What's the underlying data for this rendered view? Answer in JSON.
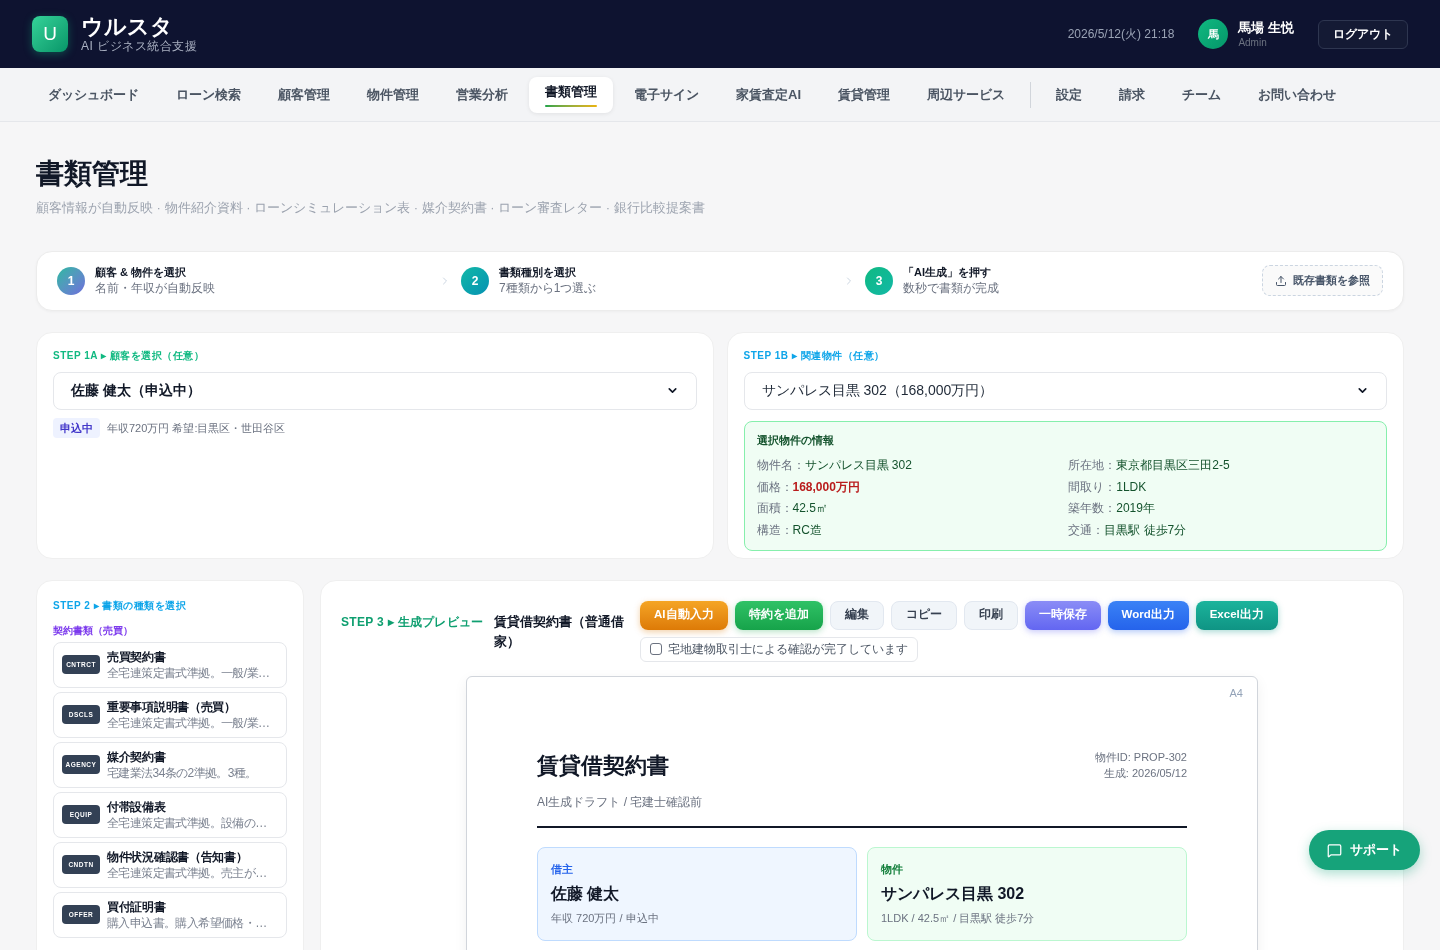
{
  "header": {
    "logo_mark": "U",
    "app_name": "ウルスタ",
    "tagline": "AI ビジネス統合支援",
    "datetime": "2026/5/12(火) 21:18",
    "user": {
      "avatar_initial": "馬",
      "name": "馬場 生悦",
      "role": "Admin"
    },
    "logout_label": "ログアウト"
  },
  "nav": {
    "primary": [
      {
        "label": "ダッシュボード",
        "selected": false
      },
      {
        "label": "ローン検索",
        "selected": false
      },
      {
        "label": "顧客管理",
        "selected": false
      },
      {
        "label": "物件管理",
        "selected": false
      },
      {
        "label": "営業分析",
        "selected": false
      },
      {
        "label": "書類管理",
        "selected": true
      },
      {
        "label": "電子サイン",
        "selected": false
      },
      {
        "label": "家賃査定AI",
        "selected": false
      },
      {
        "label": "賃貸管理",
        "selected": false
      },
      {
        "label": "周辺サービス",
        "selected": false
      }
    ],
    "secondary": [
      {
        "label": "設定",
        "selected": false
      },
      {
        "label": "請求",
        "selected": false
      },
      {
        "label": "チーム",
        "selected": false
      },
      {
        "label": "お問い合わせ",
        "selected": false
      }
    ]
  },
  "page": {
    "title": "書類管理",
    "subtitle": "顧客情報が自動反映 · 物件紹介資料 · ローンシミュレーション表 · 媒介契約書 · ローン審査レター · 銀行比較提案書"
  },
  "steps": [
    {
      "number": "1",
      "title": "顧客 & 物件を選択",
      "hint": "名前・年収が自動反映"
    },
    {
      "number": "2",
      "title": "書類種別を選択",
      "hint": "7種類から1つ選ぶ"
    },
    {
      "number": "3",
      "title": "「AI生成」を押す",
      "hint": "数秒で書類が完成"
    }
  ],
  "browse_button": "既存書類を参照",
  "customer_panel": {
    "label": "STEP 1A ▸ 顧客を選択（任意）",
    "select_value": "佐藤 健太（申込中）",
    "status": "申込中",
    "summary": "年収720万円 希望:目黒区・世田谷区"
  },
  "property_panel": {
    "label": "STEP 1B ▸ 関連物件（任意）",
    "select_value": "サンパレス目黒 302（168,000万円）",
    "info": {
      "title": "選択物件の情報",
      "fields": [
        {
          "label": "物件名：",
          "value": "サンパレス目黒 302",
          "highlighted": false
        },
        {
          "label": "所在地：",
          "value": "東京都目黒区三田2-5",
          "highlighted": false
        },
        {
          "label": "価格：",
          "value": "168,000万円",
          "highlighted": true
        },
        {
          "label": "間取り：",
          "value": "1LDK",
          "highlighted": false
        },
        {
          "label": "面積：",
          "value": "42.5㎡",
          "highlighted": false
        },
        {
          "label": "築年数：",
          "value": "2019年",
          "highlighted": false
        },
        {
          "label": "構造：",
          "value": "RC造",
          "highlighted": false
        },
        {
          "label": "交通：",
          "value": "目黒駅 徒歩7分",
          "highlighted": false
        }
      ]
    }
  },
  "document_types": {
    "label": "STEP 2 ▸ 書類の種類を選択",
    "group": "契約書類（売買）",
    "items": [
      {
        "code": "CNTRCT",
        "title": "売買契約書",
        "description": "全宅連策定書式準拠。一般/業…",
        "selected": false
      },
      {
        "code": "DSCLS",
        "title": "重要事項説明書（売買）",
        "description": "全宅連策定書式準拠。一般/業…",
        "selected": false
      },
      {
        "code": "AGENCY",
        "title": "媒介契約書",
        "description": "宅建業法34条の2準拠。3種。",
        "selected": false
      },
      {
        "code": "EQUIP",
        "title": "付帯設備表",
        "description": "全宅連策定書式準拠。設備の…",
        "selected": false
      },
      {
        "code": "CNDTN",
        "title": "物件状況確認書（告知書）",
        "description": "全宅連策定書式準拠。売主が…",
        "selected": false
      },
      {
        "code": "OFFER",
        "title": "買付証明書",
        "description": "購入申込書。購入希望価格・…",
        "selected": false
      }
    ]
  },
  "preview": {
    "label": "STEP 3 ▸ 生成プレビュー",
    "title": "賃貸借契約書（普通借家）",
    "actions": [
      {
        "label": "AI自動入力",
        "kind": "ai"
      },
      {
        "label": "特約を追加",
        "kind": "add"
      },
      {
        "label": "編集",
        "kind": "plain"
      },
      {
        "label": "コピー",
        "kind": "plain"
      },
      {
        "label": "印刷",
        "kind": "plain"
      },
      {
        "label": "一時保存",
        "kind": "save"
      },
      {
        "label": "Word出力",
        "kind": "word"
      },
      {
        "label": "Excel出力",
        "kind": "excel"
      }
    ],
    "confirmation": {
      "label": "宅地建物取引士による確認が完了しています",
      "checked": false
    },
    "document": {
      "paper_size": "A4",
      "title": "賃貸借契約書",
      "meta": [
        "物件ID: PROP-302",
        "生成: 2026/05/12"
      ],
      "status": "AI生成ドラフト / 宅建士確認前",
      "parties": [
        {
          "kind": "tenant",
          "label": "借主",
          "name": "佐藤 健太",
          "detail": "年収 720万円 / 申込中"
        },
        {
          "kind": "property",
          "label": "物件",
          "name": "サンパレス目黒 302",
          "detail": "1LDK / 42.5㎡ / 目黒駅 徒歩7分"
        }
      ]
    }
  },
  "support_button": "サポート"
}
